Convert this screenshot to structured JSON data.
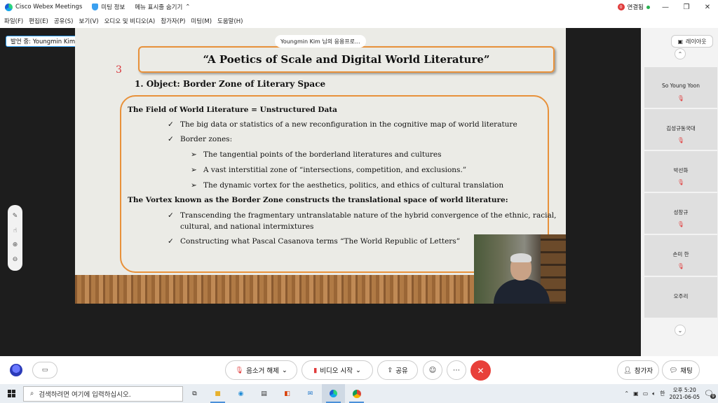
{
  "titlebar": {
    "app_name": "Cisco Webex Meetings",
    "meeting_info": "미팅 정보",
    "hide_menu": "메뉴 표시줄 숨기기",
    "connection_badge": "0",
    "connection_label": "연결됨"
  },
  "menubar": {
    "items": [
      "파일(F)",
      "편집(E)",
      "공유(S)",
      "보기(V)",
      "오디오 및 비디오(A)",
      "참가자(P)",
      "미팅(M)",
      "도움말(H)"
    ]
  },
  "stage": {
    "speaker_label": "발언 중: Youngmin Kim",
    "share_label": "Youngmin Kim 님의 응용프로..."
  },
  "slide": {
    "title": "“A Poetics of Scale and Digital World Literature”",
    "slide_number": "3",
    "heading": "1. Object: Border Zone of Literary Space",
    "lines": [
      {
        "marker": "",
        "text": "The Field of World Literature = Unstructured Data"
      },
      {
        "marker": "✓",
        "text": "The big data or statistics of a new reconfiguration in the cognitive map of world literature"
      },
      {
        "marker": "✓",
        "text": "Border zones:"
      },
      {
        "marker": "➢",
        "text": "The tangential points of the borderland literatures and cultures"
      },
      {
        "marker": "➢",
        "text": "A vast interstitial zone of “intersections, competition, and exclusions.”"
      },
      {
        "marker": "➢",
        "text": "The dynamic vortex for the aesthetics, politics, and ethics of cultural translation"
      },
      {
        "marker": "",
        "text": "The Vortex known as the Border Zone constructs the translational space of world literature:"
      },
      {
        "marker": "✓",
        "text": "Transcending the fragmentary untranslatable nature of the hybrid convergence of the ethnic, racial,"
      },
      {
        "marker": "",
        "text": "cultural, and national intermixtures"
      },
      {
        "marker": "✓",
        "text": "Constructing what Pascal Casanova terms “The World Republic of Letters”"
      }
    ]
  },
  "side_panel": {
    "layout_label": "레이아웃",
    "participants": [
      {
        "name": "So Young Yoon"
      },
      {
        "name": "김성규동국대"
      },
      {
        "name": "박선화"
      },
      {
        "name": "성창규"
      },
      {
        "name": "손미 한"
      },
      {
        "name": "오주리"
      }
    ]
  },
  "controls": {
    "mute_label": "음소거 해제",
    "video_label": "비디오 시작",
    "share_label": "공유",
    "participants_label": "참가자",
    "chat_label": "채팅"
  },
  "taskbar": {
    "search_placeholder": "검색하려면 여기에 입력하십시오.",
    "ime": "한",
    "time": "오후 5:20",
    "date": "2021-06-05",
    "notification_count": "9"
  },
  "colors": {
    "accent_orange": "#e8913a",
    "slide_number_red": "#d8353a",
    "end_call_red": "#e8403a",
    "speaker_border_blue": "#2a9df4"
  }
}
